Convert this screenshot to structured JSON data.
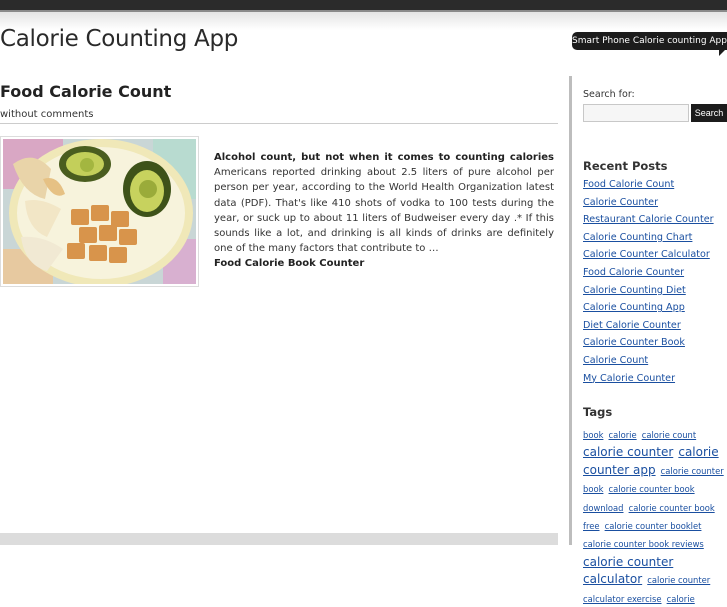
{
  "site": {
    "title": "Calorie Counting App",
    "tagline": "Smart Phone Calorie counting Apps"
  },
  "post": {
    "title": "Food Calorie Count",
    "meta": "without comments",
    "image_icon": "food-photo-icon",
    "excerpt_lead": "Alcohol count, but not when it comes to counting calories",
    "excerpt_body": " Americans reported drinking about 2.5 liters of pure alcohol per person per year, according to the World Health Organization latest data (PDF). That's like 410 shots of vodka to 100 tests during the year, or suck up to about 11 liters of Budweiser every day .* If this sounds like a lot, and drinking is all kinds of drinks are definitely one of the many factors that contribute to …",
    "read_more": "Food Calorie Book Counter"
  },
  "sidebar": {
    "search": {
      "label": "Search for:",
      "value": "",
      "placeholder": "",
      "button_label": "Search"
    },
    "recent_posts": {
      "title": "Recent Posts",
      "items": [
        "Food Calorie Count",
        "Calorie Counter",
        "Restaurant Calorie Counter",
        "Calorie Counting Chart",
        "Calorie Counter Calculator",
        "Food Calorie Counter",
        "Calorie Counting Diet",
        "Calorie Counting App",
        "Diet Calorie Counter",
        "Calorie Counter Book",
        "Calorie Count",
        "My Calorie Counter"
      ]
    },
    "tags": {
      "title": "Tags",
      "items": [
        {
          "label": "book",
          "size": "s"
        },
        {
          "label": "calorie",
          "size": "s"
        },
        {
          "label": "calorie count",
          "size": "s"
        },
        {
          "label": "calorie counter",
          "size": "l"
        },
        {
          "label": "calorie counter app",
          "size": "l"
        },
        {
          "label": "calorie counter book",
          "size": "s"
        },
        {
          "label": "calorie counter book download",
          "size": "s"
        },
        {
          "label": "calorie counter book free",
          "size": "s"
        },
        {
          "label": "calorie counter booklet",
          "size": "s"
        },
        {
          "label": "calorie counter book reviews",
          "size": "s"
        },
        {
          "label": "calorie counter calculator",
          "size": "l"
        },
        {
          "label": "calorie counter calculator exercise",
          "size": "s"
        },
        {
          "label": "calorie",
          "size": "s"
        }
      ]
    }
  },
  "colors": {
    "link": "#1a4fa0",
    "dark": "#1c1c1c",
    "rule": "#bdbdbd"
  }
}
